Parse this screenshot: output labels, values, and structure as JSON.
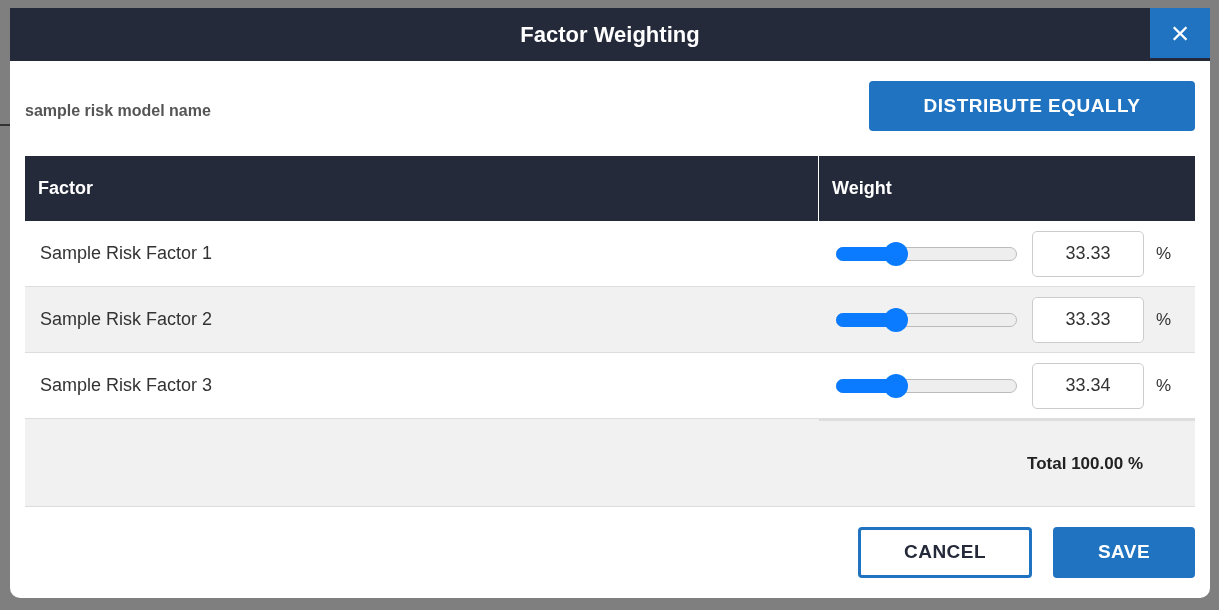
{
  "dialog": {
    "title": "Factor Weighting",
    "close_label": "×"
  },
  "model_name": "sample risk model name",
  "distribute_button": "DISTRIBUTE EQUALLY",
  "table": {
    "columns": [
      "Factor",
      "Weight"
    ],
    "rows": [
      {
        "factor": "Sample Risk Factor 1",
        "level": 0.3333,
        "value": "33.33",
        "unit": "%"
      },
      {
        "factor": "Sample Risk Factor 2",
        "level": 0.3333,
        "value": "33.33",
        "unit": "%"
      },
      {
        "factor": "Sample Risk Factor 3",
        "level": 0.3333,
        "value": "33.34",
        "unit": "%"
      }
    ],
    "total": "Total 100.00 %"
  },
  "buttons": [
    {
      "label": "CANCEL",
      "kind": "secondary"
    },
    {
      "label": "SAVE",
      "kind": "primary"
    }
  ]
}
